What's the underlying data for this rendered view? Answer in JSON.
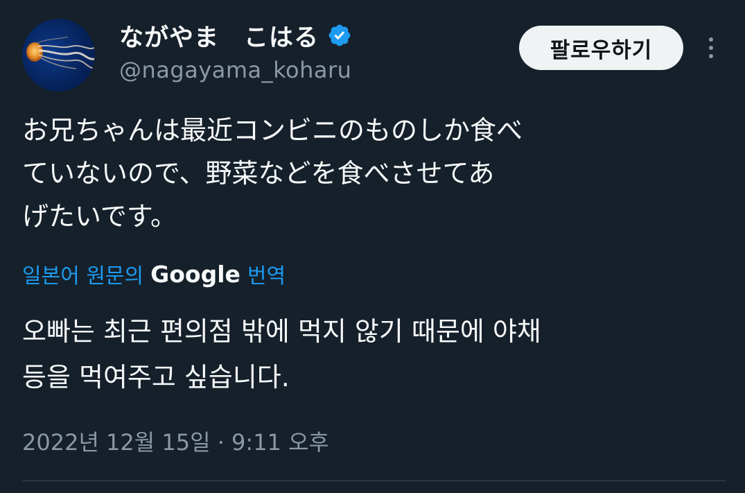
{
  "author": {
    "display_name": "ながやま　こはる",
    "handle": "@nagayama_koharu",
    "verified": true,
    "avatar_icon": "jellyfish-avatar"
  },
  "actions": {
    "follow_label": "팔로우하기",
    "more_icon": "more-options-icon"
  },
  "tweet": {
    "text_lines": [
      "お兄ちゃんは最近コンビニのものしか食べ",
      "ていないので、野菜などを食べさせてあ",
      "げたいです。"
    ]
  },
  "translation": {
    "prefix": "일본어 원문의",
    "provider": "Google",
    "suffix": "번역",
    "text_lines": [
      "오빠는 최근 편의점 밖에 먹지 않기 때문에 야채",
      "등을 먹여주고 싶습니다."
    ]
  },
  "meta": {
    "timestamp": "2022년 12월 15일 · 9:11 오후"
  },
  "colors": {
    "background": "#15202b",
    "primary_text": "#f7f9f9",
    "secondary_text": "#8b98a5",
    "link": "#1d9bf0",
    "verified_badge": "#1d9bf0",
    "follow_button_bg": "#eff3f4"
  }
}
